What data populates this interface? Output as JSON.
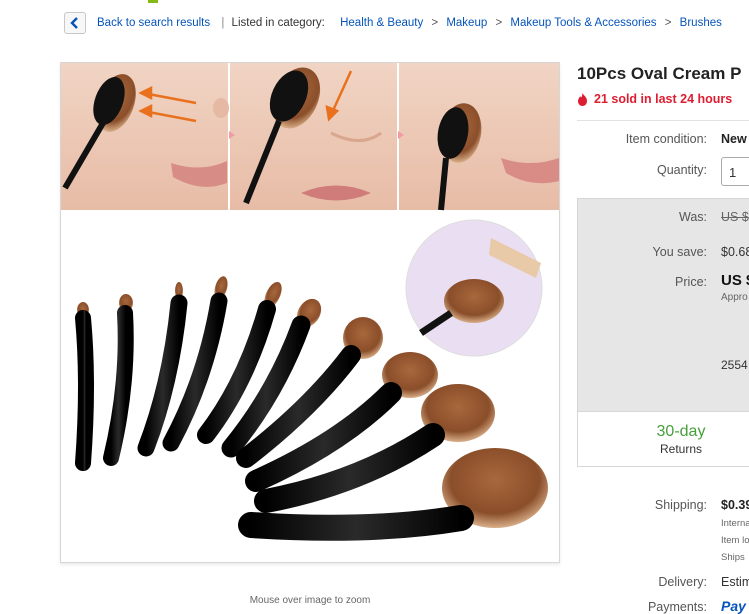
{
  "breadcrumb": {
    "back_label": "Back to search results",
    "listed_label": "Listed in category:",
    "categories": [
      "Health & Beauty",
      "Makeup",
      "Makeup Tools & Accessories",
      "Brushes"
    ]
  },
  "image": {
    "zoom_hint": "Mouse over image to zoom"
  },
  "product": {
    "title": "10Pcs Oval Cream P",
    "sold_text": "21 sold in last 24 hours",
    "condition_label": "Item condition:",
    "condition_value": "New",
    "quantity_label": "Quantity:",
    "quantity_value": "1"
  },
  "pricing": {
    "was_label": "Was:",
    "was_value": "US $",
    "save_label": "You save:",
    "save_value": "$0.68",
    "price_label": "Price:",
    "price_value": "US $",
    "approx_value": "Appro",
    "sold_count": "2554"
  },
  "returns": {
    "days": "30-day",
    "label": "Returns"
  },
  "shipping": {
    "label": "Shipping:",
    "value": "$0.39",
    "line1": "Interna",
    "line2": "Item lo",
    "line3": "Ships "
  },
  "delivery": {
    "label": "Delivery:",
    "value": "Estim"
  },
  "payments": {
    "label": "Payments:",
    "value": "Pay"
  },
  "colors": {
    "link": "#0654ba",
    "sold_red": "#dd1e31",
    "returns_green": "#469f3a",
    "price_box_bg": "#e6e6e6"
  }
}
